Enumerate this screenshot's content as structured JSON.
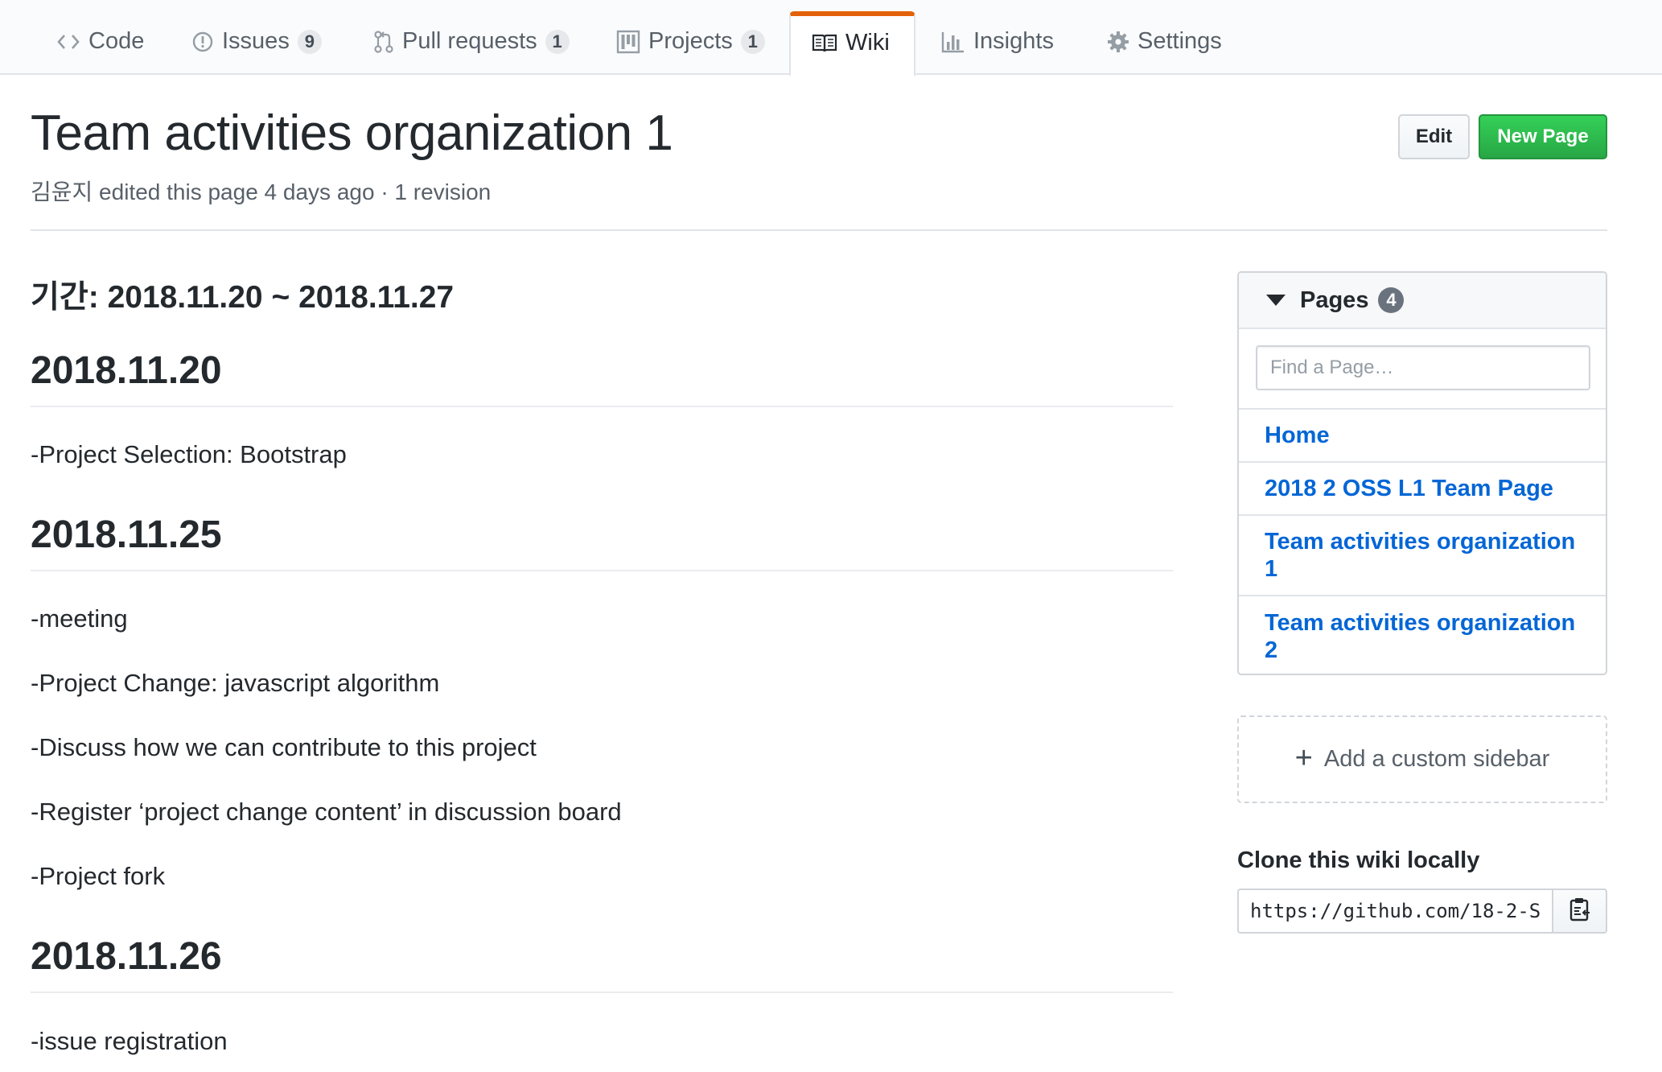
{
  "tabs": {
    "code": {
      "label": "Code",
      "icon": "code-icon"
    },
    "issues": {
      "label": "Issues",
      "count": "9",
      "icon": "issue-opened-icon"
    },
    "pulls": {
      "label": "Pull requests",
      "count": "1",
      "icon": "git-pull-request-icon"
    },
    "projects": {
      "label": "Projects",
      "count": "1",
      "icon": "project-icon"
    },
    "wiki": {
      "label": "Wiki",
      "icon": "book-icon",
      "selected": true
    },
    "insights": {
      "label": "Insights",
      "icon": "graph-icon"
    },
    "settings": {
      "label": "Settings",
      "icon": "gear-icon"
    }
  },
  "header": {
    "title": "Team activities organization 1",
    "meta": "김윤지 edited this page 4 days ago · 1 revision",
    "edit_label": "Edit",
    "new_page_label": "New Page"
  },
  "wiki": {
    "period": "기간: 2018.11.20 ~ 2018.11.27",
    "sections": [
      {
        "date": "2018.11.20",
        "items": [
          "-Project Selection: Bootstrap"
        ]
      },
      {
        "date": "2018.11.25",
        "items": [
          "-meeting",
          "-Project Change: javascript algorithm",
          "-Discuss how we can contribute to this project",
          "-Register ‘project change content’ in discussion board",
          "-Project fork"
        ]
      },
      {
        "date": "2018.11.26",
        "items": [
          "-issue registration"
        ]
      }
    ]
  },
  "sidebar": {
    "pages_label": "Pages",
    "pages_count": "4",
    "find_placeholder": "Find a Page…",
    "pages": [
      "Home",
      "2018 2 OSS L1 Team Page",
      "Team activities organization 1",
      "Team activities organization 2"
    ],
    "custom_sidebar_label": "Add a custom sidebar",
    "clone_title": "Clone this wiki locally",
    "clone_url": "https://github.com/18-2-S"
  },
  "colors": {
    "accent_tab": "#e36209",
    "link": "#0366d6",
    "primary_button": "#28a745",
    "border": "#e1e4e8"
  }
}
